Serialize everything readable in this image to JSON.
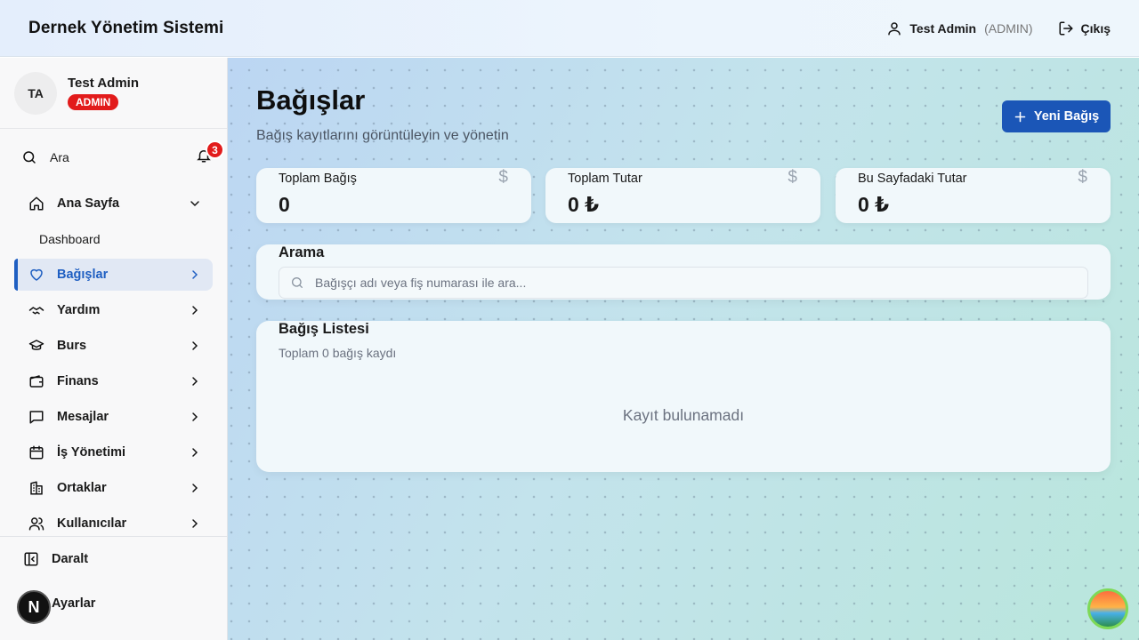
{
  "header": {
    "app_title": "Dernek Yönetim Sistemi",
    "user_name": "Test Admin",
    "user_role": "(ADMIN)",
    "logout_label": "Çıkış"
  },
  "sidebar": {
    "profile": {
      "initials": "TA",
      "name": "Test Admin",
      "role_badge": "ADMIN"
    },
    "search_label": "Ara",
    "notification_count": "3",
    "items": [
      {
        "label": "Ana Sayfa",
        "icon": "home-icon",
        "expanded": true
      },
      {
        "label": "Dashboard",
        "sub": true
      },
      {
        "label": "Bağışlar",
        "icon": "heart-icon",
        "active": true
      },
      {
        "label": "Yardım",
        "icon": "handshake-icon"
      },
      {
        "label": "Burs",
        "icon": "graduation-cap-icon"
      },
      {
        "label": "Finans",
        "icon": "wallet-icon"
      },
      {
        "label": "Mesajlar",
        "icon": "message-icon"
      },
      {
        "label": "İş Yönetimi",
        "icon": "calendar-icon"
      },
      {
        "label": "Ortaklar",
        "icon": "building-icon"
      },
      {
        "label": "Kullanıcılar",
        "icon": "users-icon"
      }
    ],
    "collapse_label": "Daralt",
    "settings_label": "Ayarlar",
    "n_badge": "N"
  },
  "page": {
    "title": "Bağışlar",
    "subtitle": "Bağış kayıtlarını görüntüleyin ve yönetin",
    "new_button": "Yeni Bağış"
  },
  "stats": [
    {
      "label": "Toplam Bağış",
      "value": "0",
      "icon": "$"
    },
    {
      "label": "Toplam Tutar",
      "value": "0 ₺",
      "icon": "$"
    },
    {
      "label": "Bu Sayfadaki Tutar",
      "value": "0 ₺",
      "icon": "$"
    }
  ],
  "search_panel": {
    "title": "Arama",
    "placeholder": "Bağışçı adı veya fiş numarası ile ara..."
  },
  "list_panel": {
    "title": "Bağış Listesi",
    "subtitle": "Toplam 0 bağış kaydı",
    "empty_text": "Kayıt bulunamadı"
  },
  "colors": {
    "accent": "#1f5fc2",
    "primary_button": "#1b56b7",
    "danger": "#e21b1b"
  }
}
